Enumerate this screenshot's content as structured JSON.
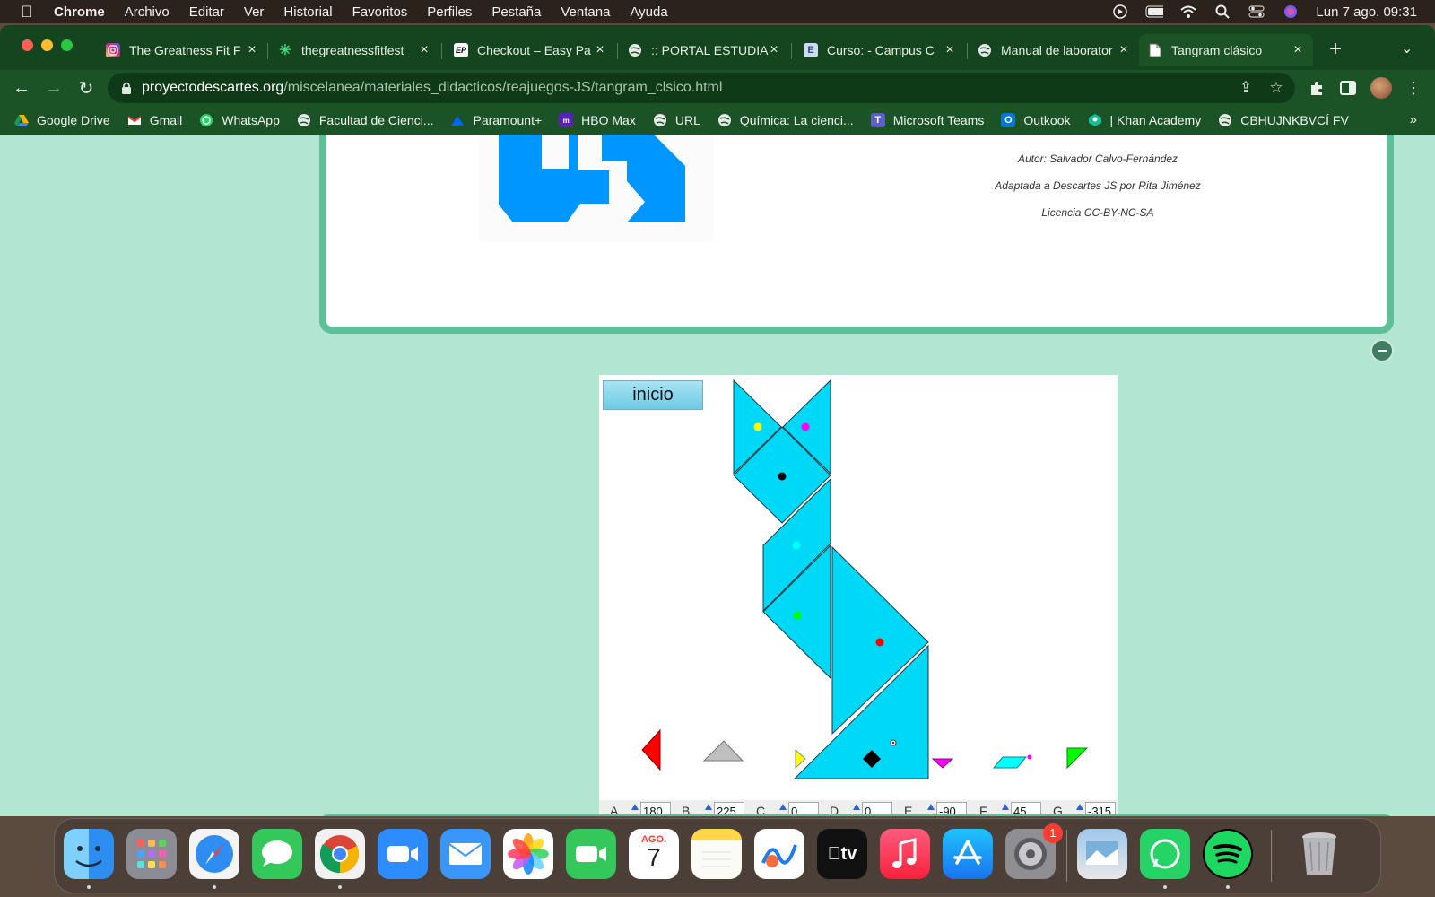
{
  "menubar": {
    "app_name": "Chrome",
    "items": [
      "Archivo",
      "Editar",
      "Ver",
      "Historial",
      "Favoritos",
      "Perfiles",
      "Pestaña",
      "Ventana",
      "Ayuda"
    ],
    "clock": "Lun 7 ago. 09:31"
  },
  "tabs": [
    {
      "title": "The Greatness Fit F",
      "icon": "instagram-icon",
      "color": "#d6249f"
    },
    {
      "title": "thegreatnessfitfest",
      "icon": "sparkle-icon",
      "color": "#3ddc84"
    },
    {
      "title": "Checkout – Easy Pa",
      "icon": "easypay-icon",
      "color": "#111111"
    },
    {
      "title": ":: PORTAL ESTUDIA",
      "icon": "globe-icon",
      "color": "#ffffff"
    },
    {
      "title": "Curso: - Campus C",
      "icon": "campus-icon",
      "color": "#5a8fd0"
    },
    {
      "title": "Manual de laborator",
      "icon": "globe-icon",
      "color": "#ffffff"
    },
    {
      "title": "Tangram clásico",
      "icon": "document-icon",
      "color": "#ffffff"
    }
  ],
  "address": {
    "host": "proyectodescartes.org",
    "path": "/miscelanea/materiales_didacticos/reajuegos-JS/tangram_clsico.html"
  },
  "bookmarks": [
    {
      "label": "Google Drive",
      "icon": "google-drive-icon",
      "color": "#f4b400"
    },
    {
      "label": "Gmail",
      "icon": "gmail-icon",
      "color": "#ea4335"
    },
    {
      "label": "WhatsApp",
      "icon": "whatsapp-icon",
      "color": "#25d366"
    },
    {
      "label": "Facultad de Cienci...",
      "icon": "globe-icon",
      "color": "#ffffff"
    },
    {
      "label": "Paramount+",
      "icon": "paramount-icon",
      "color": "#0064ff"
    },
    {
      "label": "HBO Max",
      "icon": "hbo-icon",
      "color": "#5822b4"
    },
    {
      "label": "URL",
      "icon": "globe-icon",
      "color": "#ffffff"
    },
    {
      "label": "Química: La cienci...",
      "icon": "globe-icon",
      "color": "#ffffff"
    },
    {
      "label": "Microsoft Teams",
      "icon": "teams-icon",
      "color": "#5b5fc7"
    },
    {
      "label": "Outkook",
      "icon": "outlook-icon",
      "color": "#0078d4"
    },
    {
      "label": "| Khan Academy",
      "icon": "khan-icon",
      "color": "#14bf96"
    },
    {
      "label": "CBHUJNKBVCÍ FV",
      "icon": "globe-icon",
      "color": "#ffffff"
    }
  ],
  "credits": {
    "author": "Autor: Salvador Calvo-Fernández",
    "adapted": "Adaptada a Descartes JS por Rita Jiménez",
    "license": "Licencia CC-BY-NC-SA"
  },
  "applet": {
    "button_label": "inicio",
    "piece_color": "#00d8f8",
    "controls": [
      {
        "label": "A",
        "value": "180"
      },
      {
        "label": "B",
        "value": "225"
      },
      {
        "label": "C",
        "value": "0"
      },
      {
        "label": "D",
        "value": "0"
      },
      {
        "label": "E",
        "value": "-90"
      },
      {
        "label": "F",
        "value": "45"
      },
      {
        "label": "G",
        "value": "-315"
      }
    ]
  },
  "dock": {
    "calendar_month": "AGO.",
    "calendar_day": "7",
    "settings_badge": "1",
    "tv_label": "tv"
  }
}
